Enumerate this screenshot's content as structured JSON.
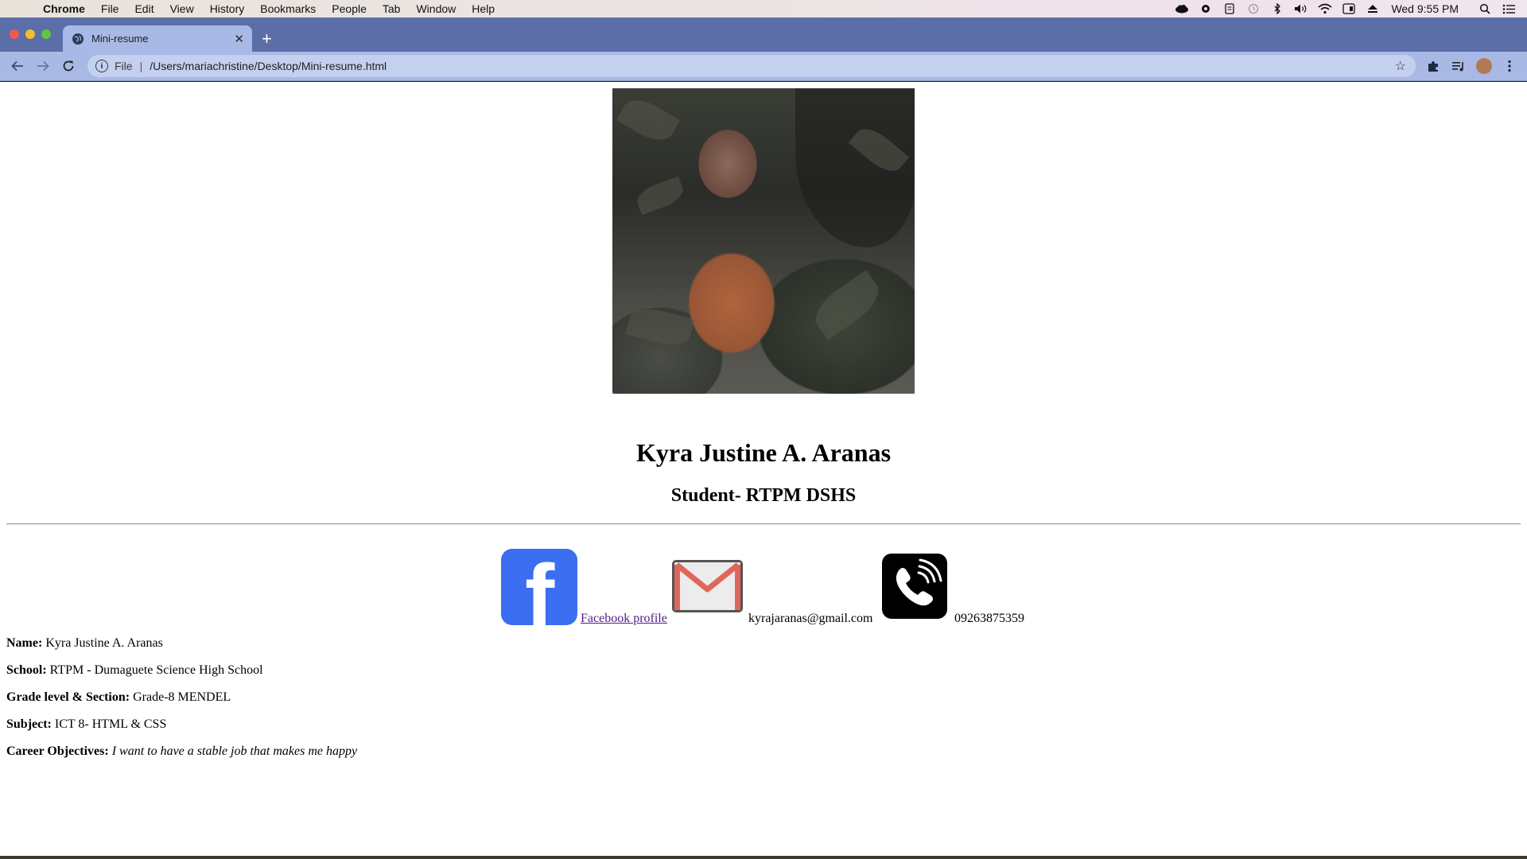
{
  "menubar": {
    "app_name": "Chrome",
    "items": [
      "File",
      "Edit",
      "View",
      "History",
      "Bookmarks",
      "People",
      "Tab",
      "Window",
      "Help"
    ],
    "clock": "Wed 9:55 PM"
  },
  "browser": {
    "tab_title": "Mini-resume",
    "url_scheme": "File",
    "url_path": "/Users/mariachristine/Desktop/Mini-resume.html"
  },
  "resume": {
    "name": "Kyra Justine A. Aranas",
    "role": "Student- RTPM DSHS",
    "contacts": {
      "facebook_label": "Facebook profile",
      "email": "kyrajaranas@gmail.com",
      "phone": "09263875359"
    },
    "details": [
      {
        "label": "Name:",
        "value": "Kyra Justine A. Aranas"
      },
      {
        "label": "School:",
        "value": "RTPM - Dumaguete Science High School"
      },
      {
        "label": "Grade level & Section:",
        "value": "Grade-8 MENDEL"
      },
      {
        "label": "Subject:",
        "value": "ICT 8- HTML & CSS"
      },
      {
        "label": "Career Objectives:",
        "value": "I want to have a stable job that makes me happy"
      }
    ]
  }
}
